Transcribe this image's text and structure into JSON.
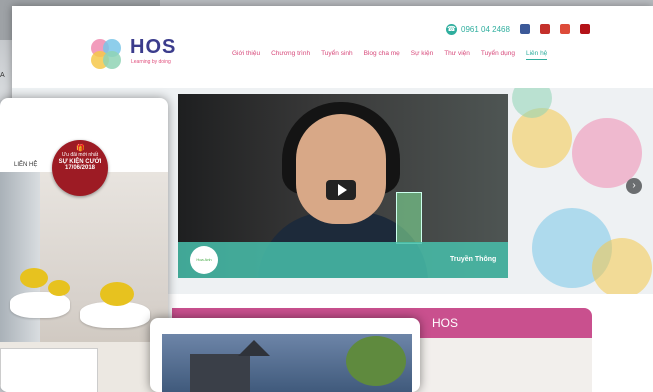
{
  "header": {
    "logo_text": "HOS",
    "logo_tagline": "Learning by doing",
    "phone": "0961 04 2468",
    "nav": [
      {
        "label": "Giới thiệu"
      },
      {
        "label": "Chương trình"
      },
      {
        "label": "Tuyển sinh"
      },
      {
        "label": "Blog cha mẹ"
      },
      {
        "label": "Sự kiện"
      },
      {
        "label": "Thư viện"
      },
      {
        "label": "Tuyển dụng"
      },
      {
        "label": "Liên hệ",
        "active": true
      }
    ],
    "social_icons": [
      "facebook-icon",
      "youtube-icon",
      "google-plus-icon",
      "youtube-alt-icon"
    ]
  },
  "hero": {
    "video_channel_logo": "Hoa Anh",
    "video_brand": "Truyền Thông",
    "next_arrow": "›"
  },
  "section": {
    "title_end": "HOS"
  },
  "left_card": {
    "header_label": "LIÊN HỆ",
    "badge_line1": "Ưu đãi mới nhất",
    "badge_line2": "SỰ KIỆN CƯỚI",
    "badge_line3": "17/06/2018"
  },
  "colors": {
    "brand_pink": "#c9508e",
    "brand_teal": "#2fae9e",
    "brand_navy": "#3b3c8c",
    "badge_red": "#9d1b24"
  }
}
